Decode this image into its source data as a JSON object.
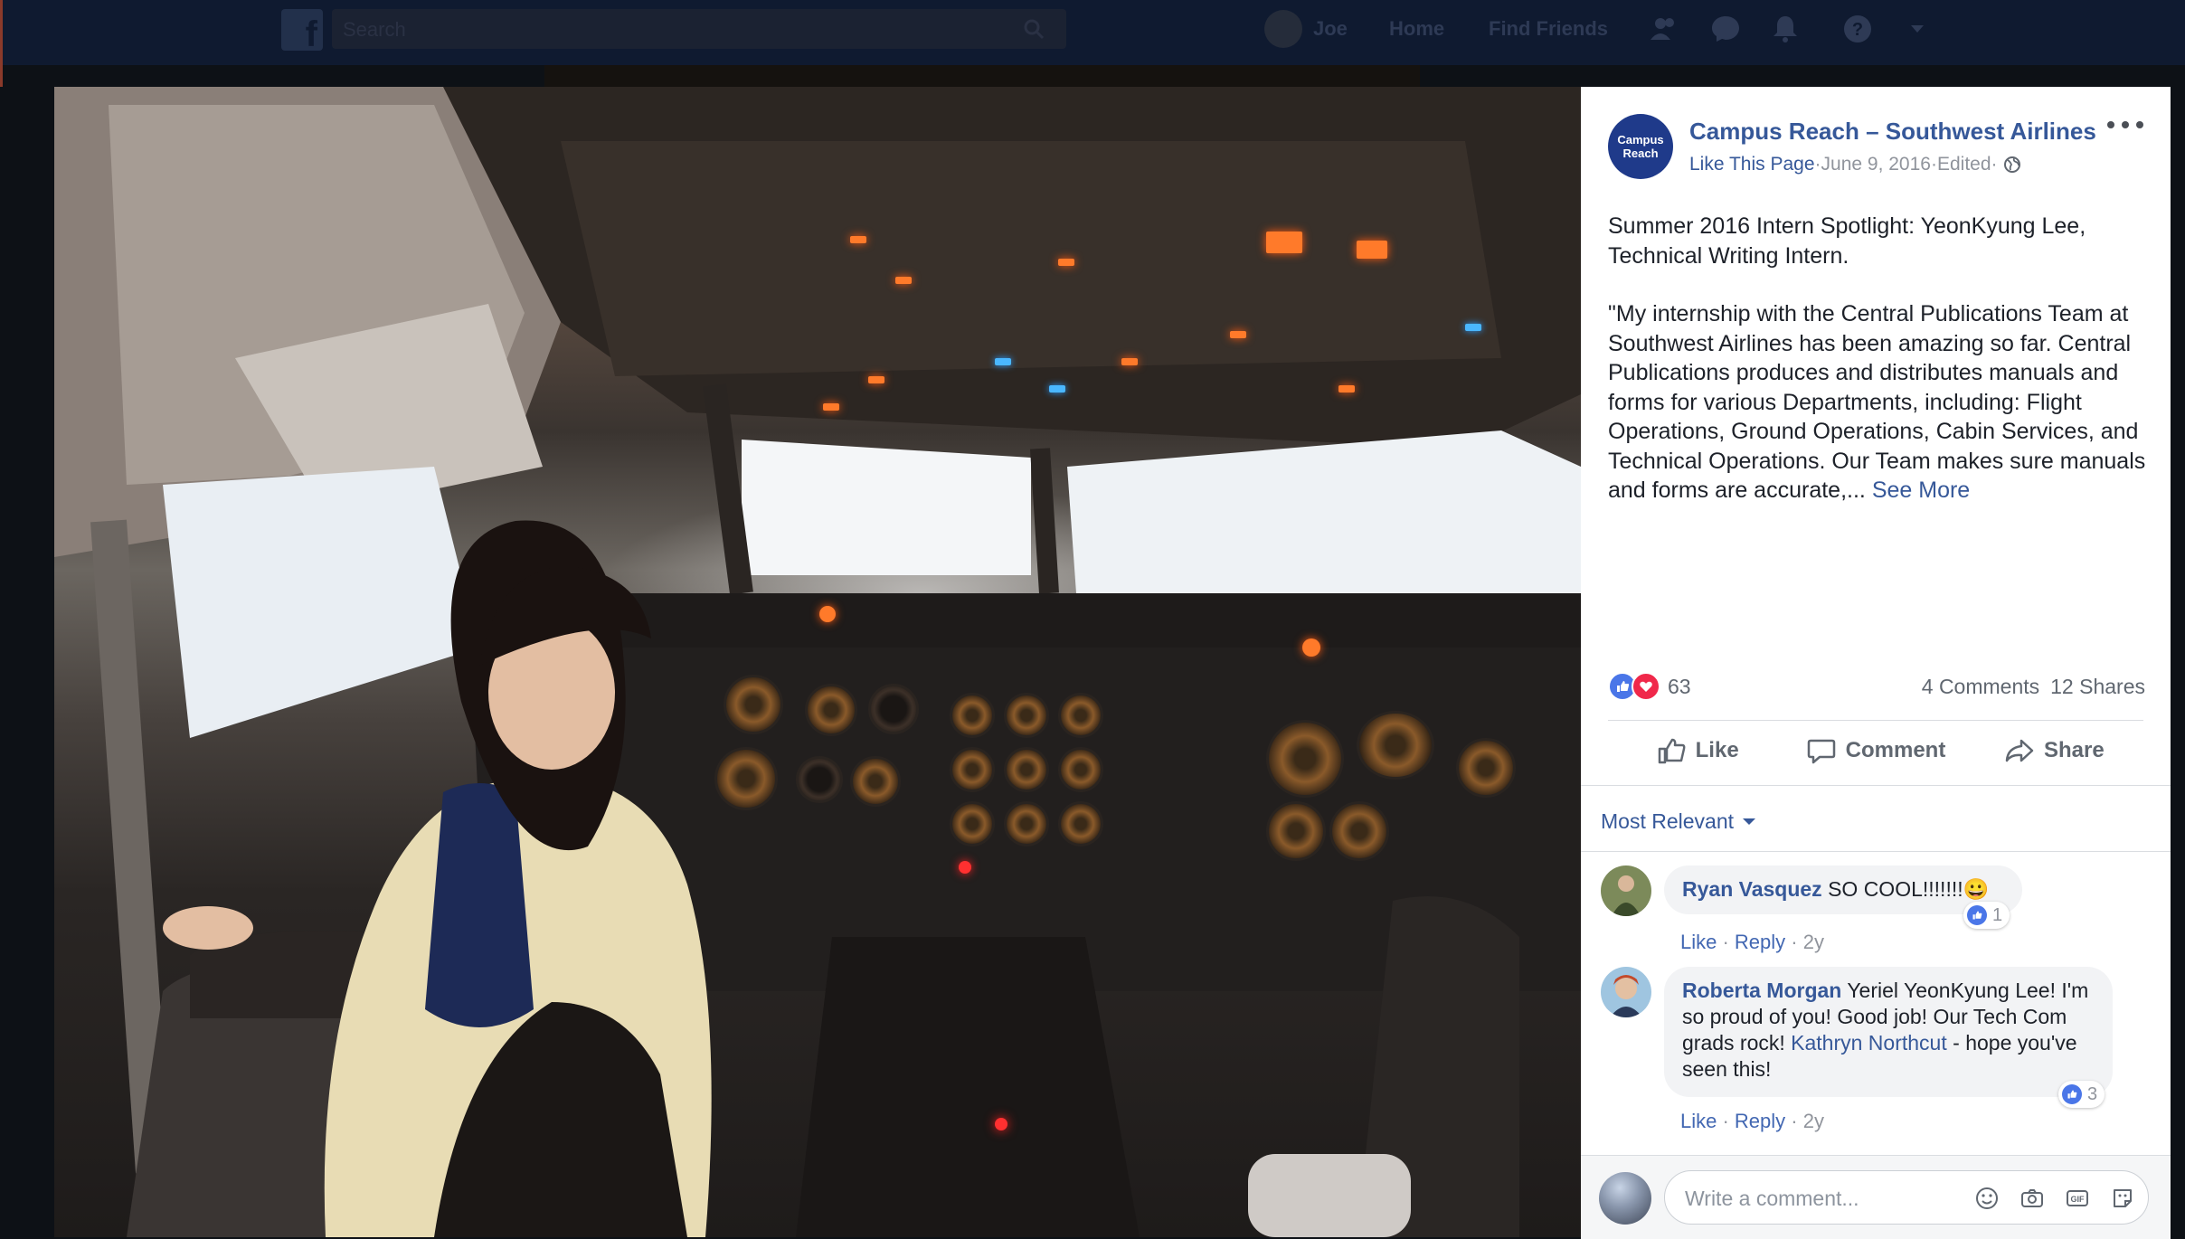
{
  "topbar": {
    "search_placeholder": "Search",
    "user_name": "Joe",
    "nav_home": "Home",
    "nav_find_friends": "Find Friends"
  },
  "post": {
    "page_name": "Campus Reach – Southwest Airlines",
    "avatar_text": "Campus Reach",
    "like_page": "Like This Page",
    "separator": " · ",
    "date": "June 9, 2016",
    "edited": "Edited",
    "body_p1": "Summer 2016 Intern Spotlight: YeonKyung Lee, Technical Writing Intern.",
    "body_p2": "\"My internship with the Central Publications Team at Southwest Airlines has been amazing so far. Central Publications produces and distributes manuals and forms for various Departments, including: Flight Operations, Ground Operations, Cabin Services, and Technical Operations. Our Team makes sure manuals and forms are accurate,...",
    "see_more": "See More",
    "reaction_count": "63",
    "comments_count": "4 Comments",
    "shares_count": "12 Shares",
    "actions": {
      "like": "Like",
      "comment": "Comment",
      "share": "Share"
    }
  },
  "comments": {
    "sort_label": "Most Relevant",
    "items": [
      {
        "author": "Ryan Vasquez",
        "text": "SO COOL!!!!!!!😀",
        "like": "Like",
        "reply": "Reply",
        "time": "2y",
        "likes": "1"
      },
      {
        "author": "Roberta Morgan",
        "text_before": "Yeriel YeonKyung Lee! I'm so proud of you! Good job! Our Tech Com grads rock! ",
        "mention": "Kathryn Northcut",
        "text_after": " - hope you've seen this!",
        "like": "Like",
        "reply": "Reply",
        "time": "2y",
        "likes": "3"
      }
    ],
    "write_placeholder": "Write a comment..."
  },
  "colors": {
    "link_blue": "#365899",
    "like_blue": "#4a76e8",
    "love_red": "#f0284a",
    "topbar_dim": "#0f1a30"
  },
  "icons": [
    "facebook-logo-icon",
    "search-icon",
    "friend-requests-icon",
    "messenger-icon",
    "notifications-icon",
    "help-icon",
    "dropdown-arrow-icon",
    "globe-icon",
    "more-options-icon",
    "like-icon",
    "comment-icon",
    "share-icon",
    "emoji-icon",
    "camera-icon",
    "gif-icon",
    "sticker-icon"
  ]
}
